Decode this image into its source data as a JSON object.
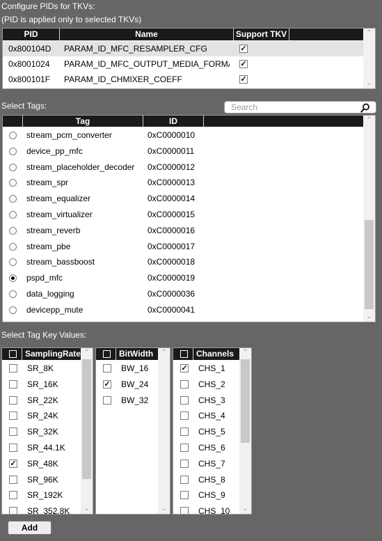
{
  "pids": {
    "heading": "Configure PIDs for TKVs:",
    "note": "(PID is applied only to selected TKVs)",
    "columns": [
      "PID",
      "Name",
      "Support TKV"
    ],
    "rows": [
      {
        "pid": "0x800104D",
        "name": "PARAM_ID_MFC_RESAMPLER_CFG",
        "support": true,
        "selected": true
      },
      {
        "pid": "0x8001024",
        "name": "PARAM_ID_MFC_OUTPUT_MEDIA_FORMA",
        "support": true,
        "selected": false
      },
      {
        "pid": "0x800101F",
        "name": "PARAM_ID_CHMIXER_COEFF",
        "support": true,
        "selected": false
      }
    ]
  },
  "tags": {
    "heading": "Select Tags:",
    "search_placeholder": "Search",
    "columns": [
      "Tag",
      "ID"
    ],
    "rows": [
      {
        "tag": "stream_pcm_converter",
        "id": "0xC0000010",
        "checked": false
      },
      {
        "tag": "device_pp_mfc",
        "id": "0xC0000011",
        "checked": false
      },
      {
        "tag": "stream_placeholder_decoder",
        "id": "0xC0000012",
        "checked": false
      },
      {
        "tag": "stream_spr",
        "id": "0xC0000013",
        "checked": false
      },
      {
        "tag": "stream_equalizer",
        "id": "0xC0000014",
        "checked": false
      },
      {
        "tag": "stream_virtualizer",
        "id": "0xC0000015",
        "checked": false
      },
      {
        "tag": "stream_reverb",
        "id": "0xC0000016",
        "checked": false
      },
      {
        "tag": "stream_pbe",
        "id": "0xC0000017",
        "checked": false
      },
      {
        "tag": "stream_bassboost",
        "id": "0xC0000018",
        "checked": false
      },
      {
        "tag": "pspd_mfc",
        "id": "0xC0000019",
        "checked": true
      },
      {
        "tag": "data_logging",
        "id": "0xC0000036",
        "checked": false
      },
      {
        "tag": "devicepp_mute",
        "id": "0xC0000041",
        "checked": false
      }
    ]
  },
  "tkv": {
    "heading": "Select Tag Key Values:",
    "lists": [
      {
        "header": "SamplingRate",
        "items": [
          {
            "label": "SR_8K",
            "checked": false
          },
          {
            "label": "SR_16K",
            "checked": false
          },
          {
            "label": "SR_22K",
            "checked": false
          },
          {
            "label": "SR_24K",
            "checked": false
          },
          {
            "label": "SR_32K",
            "checked": false
          },
          {
            "label": "SR_44.1K",
            "checked": false
          },
          {
            "label": "SR_48K",
            "checked": true
          },
          {
            "label": "SR_96K",
            "checked": false
          },
          {
            "label": "SR_192K",
            "checked": false
          },
          {
            "label": "SR_352.8K",
            "checked": false
          }
        ]
      },
      {
        "header": "BitWidth",
        "items": [
          {
            "label": "BW_16",
            "checked": false
          },
          {
            "label": "BW_24",
            "checked": true
          },
          {
            "label": "BW_32",
            "checked": false
          }
        ]
      },
      {
        "header": "Channels",
        "items": [
          {
            "label": "CHS_1",
            "checked": true
          },
          {
            "label": "CHS_2",
            "checked": false
          },
          {
            "label": "CHS_3",
            "checked": false
          },
          {
            "label": "CHS_4",
            "checked": false
          },
          {
            "label": "CHS_5",
            "checked": false
          },
          {
            "label": "CHS_6",
            "checked": false
          },
          {
            "label": "CHS_7",
            "checked": false
          },
          {
            "label": "CHS_8",
            "checked": false
          },
          {
            "label": "CHS_9",
            "checked": false
          },
          {
            "label": "CHS_10",
            "checked": false
          }
        ]
      }
    ]
  },
  "add_button": "Add",
  "icons": {
    "search": "search-icon",
    "scroll_up": "chevron-up-icon",
    "scroll_down": "chevron-down-icon"
  }
}
